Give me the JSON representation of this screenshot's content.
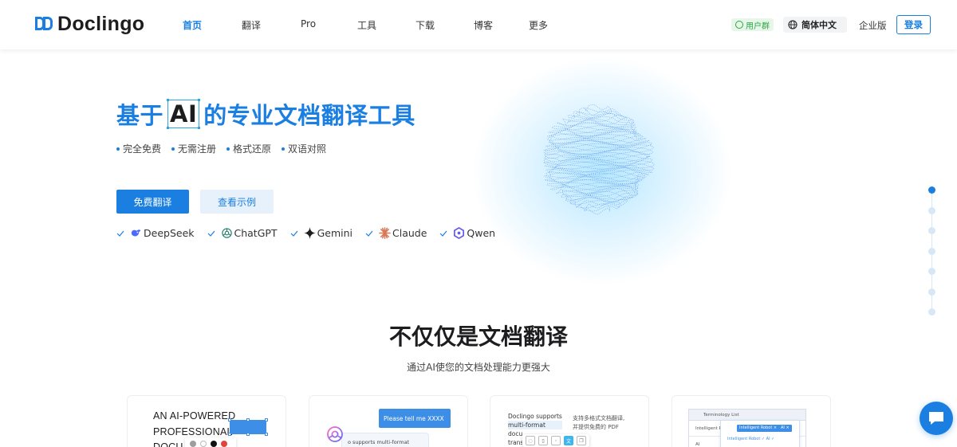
{
  "brand": {
    "name": "Doclingo",
    "accent": "#1a7fe0"
  },
  "nav": {
    "items": [
      {
        "label": "首页",
        "active": true
      },
      {
        "label": "翻译",
        "active": false
      },
      {
        "label": "Pro",
        "active": false
      },
      {
        "label": "工具",
        "active": false
      },
      {
        "label": "下载",
        "active": false
      },
      {
        "label": "博客",
        "active": false
      },
      {
        "label": "更多",
        "active": false
      }
    ],
    "user_group": "用户群",
    "language": "简体中文",
    "enterprise": "企业版",
    "login": "登录"
  },
  "hero": {
    "title_prefix": "基于",
    "title_ai": "AI",
    "title_suffix": "的专业文档翻译工具",
    "features": [
      "完全免费",
      "无需注册",
      "格式还原",
      "双语对照"
    ],
    "primary_button": "免费翻译",
    "secondary_button": "查看示例",
    "models": [
      "DeepSeek",
      "ChatGPT",
      "Gemini",
      "Claude",
      "Qwen"
    ]
  },
  "section": {
    "title": "不仅仅是文档翻译",
    "subtitle": "通过AI使您的文档处理能力更强大"
  },
  "cards": {
    "c1": {
      "lines": [
        "AN AI-POWERED",
        "PROFESSIONAL",
        "DOCU"
      ]
    },
    "c2": {
      "bubble": "Please tell me XXXX",
      "panel": "o supports multi-format"
    },
    "c3": {
      "left": [
        "Doclingo supports",
        "multi-format",
        "docu",
        "trans"
      ],
      "right": [
        "支持多格式文档翻译,",
        "并提供免费的 PDF"
      ]
    },
    "c4": {
      "header": "Terminology List",
      "rows": [
        "Intelligent Robot",
        "AI"
      ],
      "tag1": "Intelligent Robot ×",
      "tag2": "AI ×",
      "popup_text": "Intelligent Robot ✓ AI ✓"
    }
  },
  "side_nav": {
    "count": 7,
    "active_index": 0
  }
}
